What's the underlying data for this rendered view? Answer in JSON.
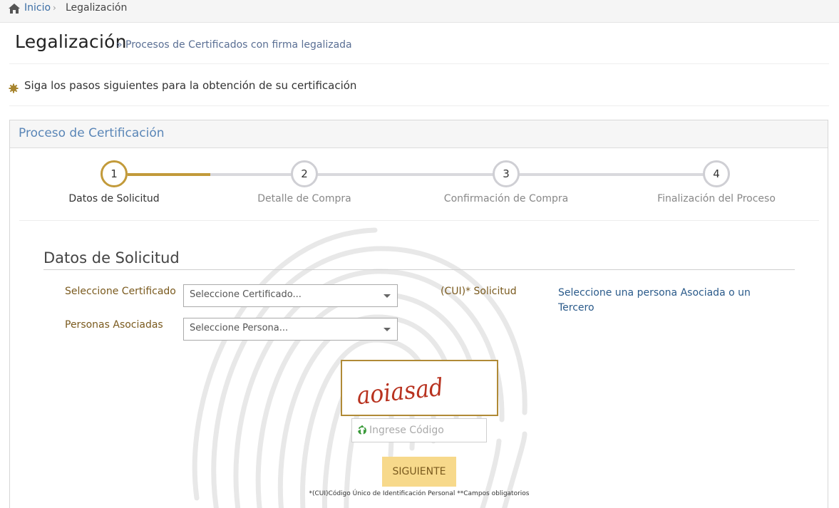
{
  "breadcrumb": {
    "home": "Inicio",
    "current": "Legalización"
  },
  "header": {
    "title": "Legalización",
    "subtitle": "» Procesos de Certificados con firma legalizada"
  },
  "instruction": "Siga los pasos siguientes para la obtención de su certificación",
  "panel": {
    "title": "Proceso de Certificación"
  },
  "wizard": {
    "steps": [
      {
        "number": "1",
        "label": "Datos de Solicitud"
      },
      {
        "number": "2",
        "label": "Detalle de Compra"
      },
      {
        "number": "3",
        "label": "Confirmación de Compra"
      },
      {
        "number": "4",
        "label": "Finalización del Proceso"
      }
    ],
    "current_step": 1
  },
  "form": {
    "section_title": "Datos de Solicitud",
    "certificado_label": "Seleccione Certificado",
    "certificado_value": "Seleccione Certificado...",
    "personas_label": "Personas Asociadas",
    "personas_value": "Seleccione Persona...",
    "cui_label": "(CUI)* Solicitud",
    "persona_link": "Seleccione una persona Asociada o un Tercero"
  },
  "captcha": {
    "text": "aoiasad",
    "input_placeholder": "Ingrese Código"
  },
  "button": {
    "next": "SIGUIENTE"
  },
  "footnote": "*(CUI)Código Único de Identificación Personal **Campos obligatorios",
  "colors": {
    "accent": "#c29a3a",
    "link": "#3b6ea5",
    "button": "#f7d98b",
    "label": "#7a5a1e"
  }
}
